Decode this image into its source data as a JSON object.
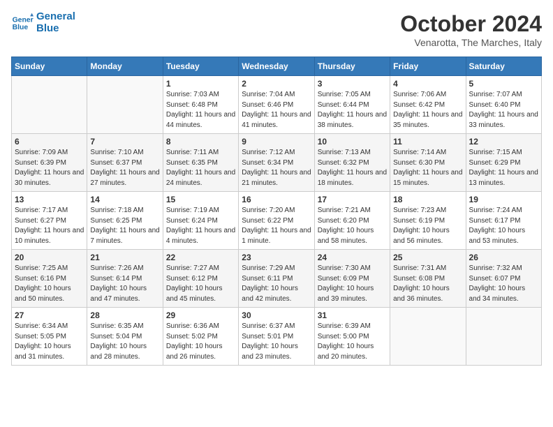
{
  "logo": {
    "line1": "General",
    "line2": "Blue"
  },
  "title": "October 2024",
  "location": "Venarotta, The Marches, Italy",
  "days_of_week": [
    "Sunday",
    "Monday",
    "Tuesday",
    "Wednesday",
    "Thursday",
    "Friday",
    "Saturday"
  ],
  "weeks": [
    [
      {
        "day": "",
        "detail": ""
      },
      {
        "day": "",
        "detail": ""
      },
      {
        "day": "1",
        "detail": "Sunrise: 7:03 AM\nSunset: 6:48 PM\nDaylight: 11 hours and 44 minutes."
      },
      {
        "day": "2",
        "detail": "Sunrise: 7:04 AM\nSunset: 6:46 PM\nDaylight: 11 hours and 41 minutes."
      },
      {
        "day": "3",
        "detail": "Sunrise: 7:05 AM\nSunset: 6:44 PM\nDaylight: 11 hours and 38 minutes."
      },
      {
        "day": "4",
        "detail": "Sunrise: 7:06 AM\nSunset: 6:42 PM\nDaylight: 11 hours and 35 minutes."
      },
      {
        "day": "5",
        "detail": "Sunrise: 7:07 AM\nSunset: 6:40 PM\nDaylight: 11 hours and 33 minutes."
      }
    ],
    [
      {
        "day": "6",
        "detail": "Sunrise: 7:09 AM\nSunset: 6:39 PM\nDaylight: 11 hours and 30 minutes."
      },
      {
        "day": "7",
        "detail": "Sunrise: 7:10 AM\nSunset: 6:37 PM\nDaylight: 11 hours and 27 minutes."
      },
      {
        "day": "8",
        "detail": "Sunrise: 7:11 AM\nSunset: 6:35 PM\nDaylight: 11 hours and 24 minutes."
      },
      {
        "day": "9",
        "detail": "Sunrise: 7:12 AM\nSunset: 6:34 PM\nDaylight: 11 hours and 21 minutes."
      },
      {
        "day": "10",
        "detail": "Sunrise: 7:13 AM\nSunset: 6:32 PM\nDaylight: 11 hours and 18 minutes."
      },
      {
        "day": "11",
        "detail": "Sunrise: 7:14 AM\nSunset: 6:30 PM\nDaylight: 11 hours and 15 minutes."
      },
      {
        "day": "12",
        "detail": "Sunrise: 7:15 AM\nSunset: 6:29 PM\nDaylight: 11 hours and 13 minutes."
      }
    ],
    [
      {
        "day": "13",
        "detail": "Sunrise: 7:17 AM\nSunset: 6:27 PM\nDaylight: 11 hours and 10 minutes."
      },
      {
        "day": "14",
        "detail": "Sunrise: 7:18 AM\nSunset: 6:25 PM\nDaylight: 11 hours and 7 minutes."
      },
      {
        "day": "15",
        "detail": "Sunrise: 7:19 AM\nSunset: 6:24 PM\nDaylight: 11 hours and 4 minutes."
      },
      {
        "day": "16",
        "detail": "Sunrise: 7:20 AM\nSunset: 6:22 PM\nDaylight: 11 hours and 1 minute."
      },
      {
        "day": "17",
        "detail": "Sunrise: 7:21 AM\nSunset: 6:20 PM\nDaylight: 10 hours and 58 minutes."
      },
      {
        "day": "18",
        "detail": "Sunrise: 7:23 AM\nSunset: 6:19 PM\nDaylight: 10 hours and 56 minutes."
      },
      {
        "day": "19",
        "detail": "Sunrise: 7:24 AM\nSunset: 6:17 PM\nDaylight: 10 hours and 53 minutes."
      }
    ],
    [
      {
        "day": "20",
        "detail": "Sunrise: 7:25 AM\nSunset: 6:16 PM\nDaylight: 10 hours and 50 minutes."
      },
      {
        "day": "21",
        "detail": "Sunrise: 7:26 AM\nSunset: 6:14 PM\nDaylight: 10 hours and 47 minutes."
      },
      {
        "day": "22",
        "detail": "Sunrise: 7:27 AM\nSunset: 6:12 PM\nDaylight: 10 hours and 45 minutes."
      },
      {
        "day": "23",
        "detail": "Sunrise: 7:29 AM\nSunset: 6:11 PM\nDaylight: 10 hours and 42 minutes."
      },
      {
        "day": "24",
        "detail": "Sunrise: 7:30 AM\nSunset: 6:09 PM\nDaylight: 10 hours and 39 minutes."
      },
      {
        "day": "25",
        "detail": "Sunrise: 7:31 AM\nSunset: 6:08 PM\nDaylight: 10 hours and 36 minutes."
      },
      {
        "day": "26",
        "detail": "Sunrise: 7:32 AM\nSunset: 6:07 PM\nDaylight: 10 hours and 34 minutes."
      }
    ],
    [
      {
        "day": "27",
        "detail": "Sunrise: 6:34 AM\nSunset: 5:05 PM\nDaylight: 10 hours and 31 minutes."
      },
      {
        "day": "28",
        "detail": "Sunrise: 6:35 AM\nSunset: 5:04 PM\nDaylight: 10 hours and 28 minutes."
      },
      {
        "day": "29",
        "detail": "Sunrise: 6:36 AM\nSunset: 5:02 PM\nDaylight: 10 hours and 26 minutes."
      },
      {
        "day": "30",
        "detail": "Sunrise: 6:37 AM\nSunset: 5:01 PM\nDaylight: 10 hours and 23 minutes."
      },
      {
        "day": "31",
        "detail": "Sunrise: 6:39 AM\nSunset: 5:00 PM\nDaylight: 10 hours and 20 minutes."
      },
      {
        "day": "",
        "detail": ""
      },
      {
        "day": "",
        "detail": ""
      }
    ]
  ]
}
